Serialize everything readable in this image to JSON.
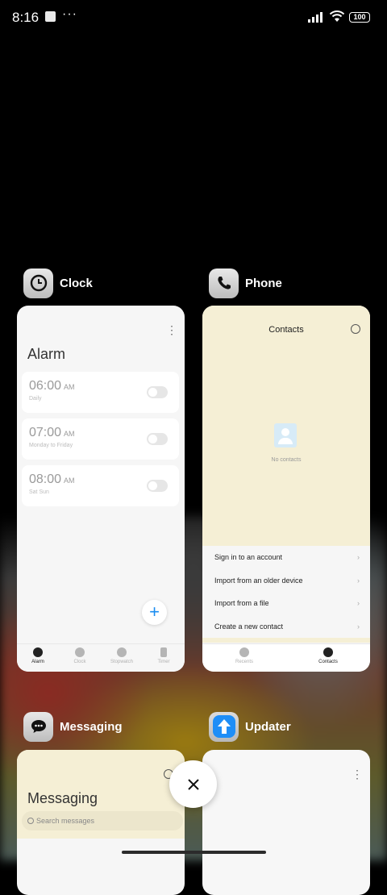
{
  "status_bar": {
    "time": "8:16",
    "more": "···",
    "battery": "100"
  },
  "recents": [
    {
      "app_name": "Clock",
      "screen": {
        "title": "Alarm",
        "alarms": [
          {
            "time": "06:00",
            "ampm": "AM",
            "repeat": "Daily"
          },
          {
            "time": "07:00",
            "ampm": "AM",
            "repeat": "Monday to Friday"
          },
          {
            "time": "08:00",
            "ampm": "AM",
            "repeat": "Sat Sun"
          }
        ],
        "fab": "+",
        "tabs": [
          "Alarm",
          "Clock",
          "Stopwatch",
          "Timer"
        ],
        "active_tab": "Alarm"
      }
    },
    {
      "app_name": "Phone",
      "screen": {
        "title": "Contacts",
        "empty_text": "No contacts",
        "menu": [
          "Sign in to an account",
          "Import from an older device",
          "Import from a file",
          "Create a new contact"
        ],
        "tabs": [
          "Recents",
          "Contacts"
        ],
        "active_tab": "Contacts"
      }
    },
    {
      "app_name": "Messaging",
      "screen": {
        "title": "Messaging",
        "search_placeholder": "Search messages"
      }
    },
    {
      "app_name": "Updater",
      "screen": {}
    }
  ],
  "close_button": "×",
  "colors": {
    "accent": "#1a8cf0",
    "phone_header_bg": "#f5efd5",
    "updater_icon": "#1e8ef7"
  }
}
